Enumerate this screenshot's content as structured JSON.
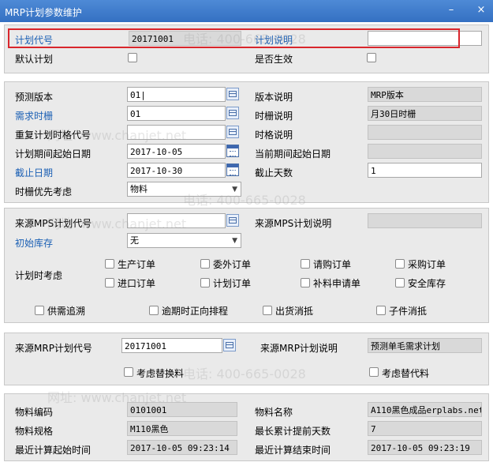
{
  "window": {
    "title": "MRP计划参数维护",
    "min_glyph": "–",
    "close_glyph": "×"
  },
  "header": {
    "plan_code_label": "计划代号",
    "plan_code_value": "20171001",
    "plan_desc_label": "计划说明",
    "plan_desc_value": "",
    "default_plan_label": "默认计划",
    "effective_label": "是否生效"
  },
  "params": {
    "forecast_version_label": "预测版本",
    "forecast_version_value": "01|",
    "version_desc_label": "版本说明",
    "version_desc_value": "MRP版本",
    "demand_bucket_label": "需求时栅",
    "demand_bucket_value": "01",
    "bucket_desc_label": "时栅说明",
    "bucket_desc_value": "月30日时栅",
    "repeat_code_label": "重复计划时格代号",
    "repeat_code_value": "",
    "grid_desc_label": "时格说明",
    "grid_desc_value": "",
    "plan_start_label": "计划期间起始日期",
    "plan_start_value": "2017-10-05",
    "current_start_label": "当前期间起始日期",
    "current_start_value": "",
    "cutoff_label": "截止日期",
    "cutoff_value": "2017-10-30",
    "cutoff_days_label": "截止天数",
    "cutoff_days_value": "1",
    "priority_label": "时栅优先考虑",
    "priority_value": "物料"
  },
  "source": {
    "mps_code_label": "来源MPS计划代号",
    "mps_code_value": "",
    "mps_desc_label": "来源MPS计划说明",
    "mps_desc_value": "",
    "initial_stock_label": "初始库存",
    "initial_stock_value": "无",
    "consider_label": "计划时考虑",
    "options": [
      "生产订单",
      "委外订单",
      "请购订单",
      "采购订单",
      "进口订单",
      "计划订单",
      "补料申请单",
      "安全库存"
    ],
    "options2": [
      "供需追溯",
      "逾期时正向排程",
      "出货消抵",
      "子件消抵"
    ]
  },
  "mrp": {
    "code_label": "来源MRP计划代号",
    "code_value": "20171001",
    "desc_label": "来源MRP计划说明",
    "desc_value": "预测单毛需求计划",
    "substitute_label": "考虑替换料",
    "alt_label": "考虑替代料"
  },
  "item": {
    "code_label": "物料编码",
    "code_value": "0101001",
    "name_label": "物料名称",
    "name_value": "A110黑色成品erplabs.net",
    "spec_label": "物料规格",
    "spec_value": "M110黑色",
    "lead_label": "最长累计提前天数",
    "lead_value": "7",
    "start_label": "最近计算起始时间",
    "start_value": "2017-10-05 09:23:14",
    "end_label": "最近计算结束时间",
    "end_value": "2017-10-05 09:23:19"
  },
  "watermark": {
    "phone": "电话: 400-665-0028",
    "site": "网址: www.chanjet.net"
  }
}
